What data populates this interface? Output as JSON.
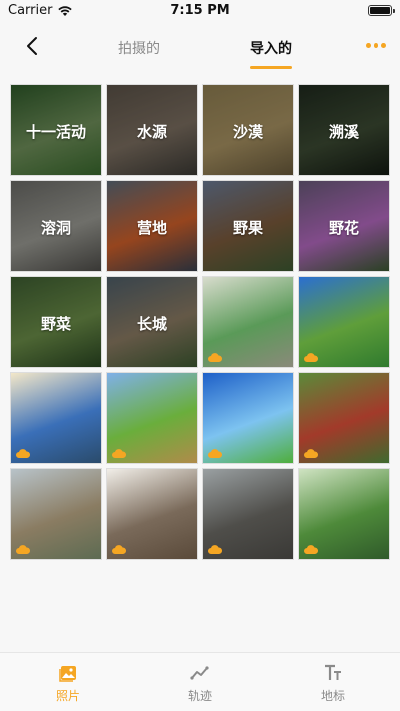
{
  "status": {
    "carrier": "Carrier",
    "time": "7:15 PM"
  },
  "nav": {
    "back_icon": "chevron-left-icon",
    "tabs": [
      {
        "label": "拍摄的",
        "active": false
      },
      {
        "label": "导入的",
        "active": true
      }
    ],
    "more_icon": "more-dots-icon",
    "accent": "#f5a623"
  },
  "grid": {
    "albums": [
      {
        "label": "十一活动",
        "palette": [
          "#2f5a2a",
          "#6f8f5a",
          "#3a6b2e"
        ]
      },
      {
        "label": "水源",
        "palette": [
          "#5b5248",
          "#7b6e60",
          "#3c3a35"
        ]
      },
      {
        "label": "沙漠",
        "palette": [
          "#8f7e52",
          "#a89262",
          "#6a5b3c"
        ]
      },
      {
        "label": "溯溪",
        "palette": [
          "#1f2a1e",
          "#3c4a33",
          "#131a12"
        ]
      },
      {
        "label": "溶洞",
        "palette": [
          "#6a6a66",
          "#9a9a93",
          "#4f4e4a"
        ]
      },
      {
        "label": "营地",
        "palette": [
          "#5e6b78",
          "#d0602a",
          "#3a4250"
        ]
      },
      {
        "label": "野果",
        "palette": [
          "#6b7b95",
          "#7b5a3c",
          "#3e5a33"
        ]
      },
      {
        "label": "野花",
        "palette": [
          "#6a5b7a",
          "#b469c0",
          "#3b5a32"
        ]
      },
      {
        "label": "野菜",
        "palette": [
          "#3e5e32",
          "#6b8d48",
          "#2a4722"
        ]
      },
      {
        "label": "长城",
        "palette": [
          "#4f5f6a",
          "#8b7b63",
          "#3e5a32"
        ]
      }
    ],
    "photos": [
      {
        "cloud": true,
        "palette": [
          "#d8dccd",
          "#5a9a58",
          "#8a8a7a"
        ]
      },
      {
        "cloud": true,
        "palette": [
          "#2b6fd0",
          "#5f9e3a",
          "#2f7a2e"
        ]
      },
      {
        "cloud": true,
        "palette": [
          "#f3e7c9",
          "#3a6fb8",
          "#2a4b6b"
        ]
      },
      {
        "cloud": true,
        "palette": [
          "#7fb0e8",
          "#6aae3c",
          "#b08b4a"
        ]
      },
      {
        "cloud": true,
        "palette": [
          "#1e60c8",
          "#7dc3f0",
          "#4fae3c"
        ]
      },
      {
        "cloud": true,
        "palette": [
          "#5b8a3a",
          "#a23a2a",
          "#3f6a2e"
        ]
      },
      {
        "cloud": true,
        "palette": [
          "#b8c3c9",
          "#8a7c62",
          "#5d6b52"
        ]
      },
      {
        "cloud": true,
        "palette": [
          "#f1eee8",
          "#7a6a5a",
          "#5a4a3a"
        ]
      },
      {
        "cloud": true,
        "palette": [
          "#9aa0a2",
          "#4f4e4a",
          "#3a3936"
        ]
      },
      {
        "cloud": true,
        "palette": [
          "#cfe3c2",
          "#4e8a3a",
          "#2f5a2a"
        ]
      }
    ]
  },
  "tabbar": {
    "items": [
      {
        "label": "照片",
        "icon": "photo-icon",
        "active": true
      },
      {
        "label": "轨迹",
        "icon": "track-icon",
        "active": false
      },
      {
        "label": "地标",
        "icon": "text-marker-icon",
        "active": false
      }
    ],
    "active_color": "#f5a623",
    "inactive_color": "#8a8a8a"
  }
}
